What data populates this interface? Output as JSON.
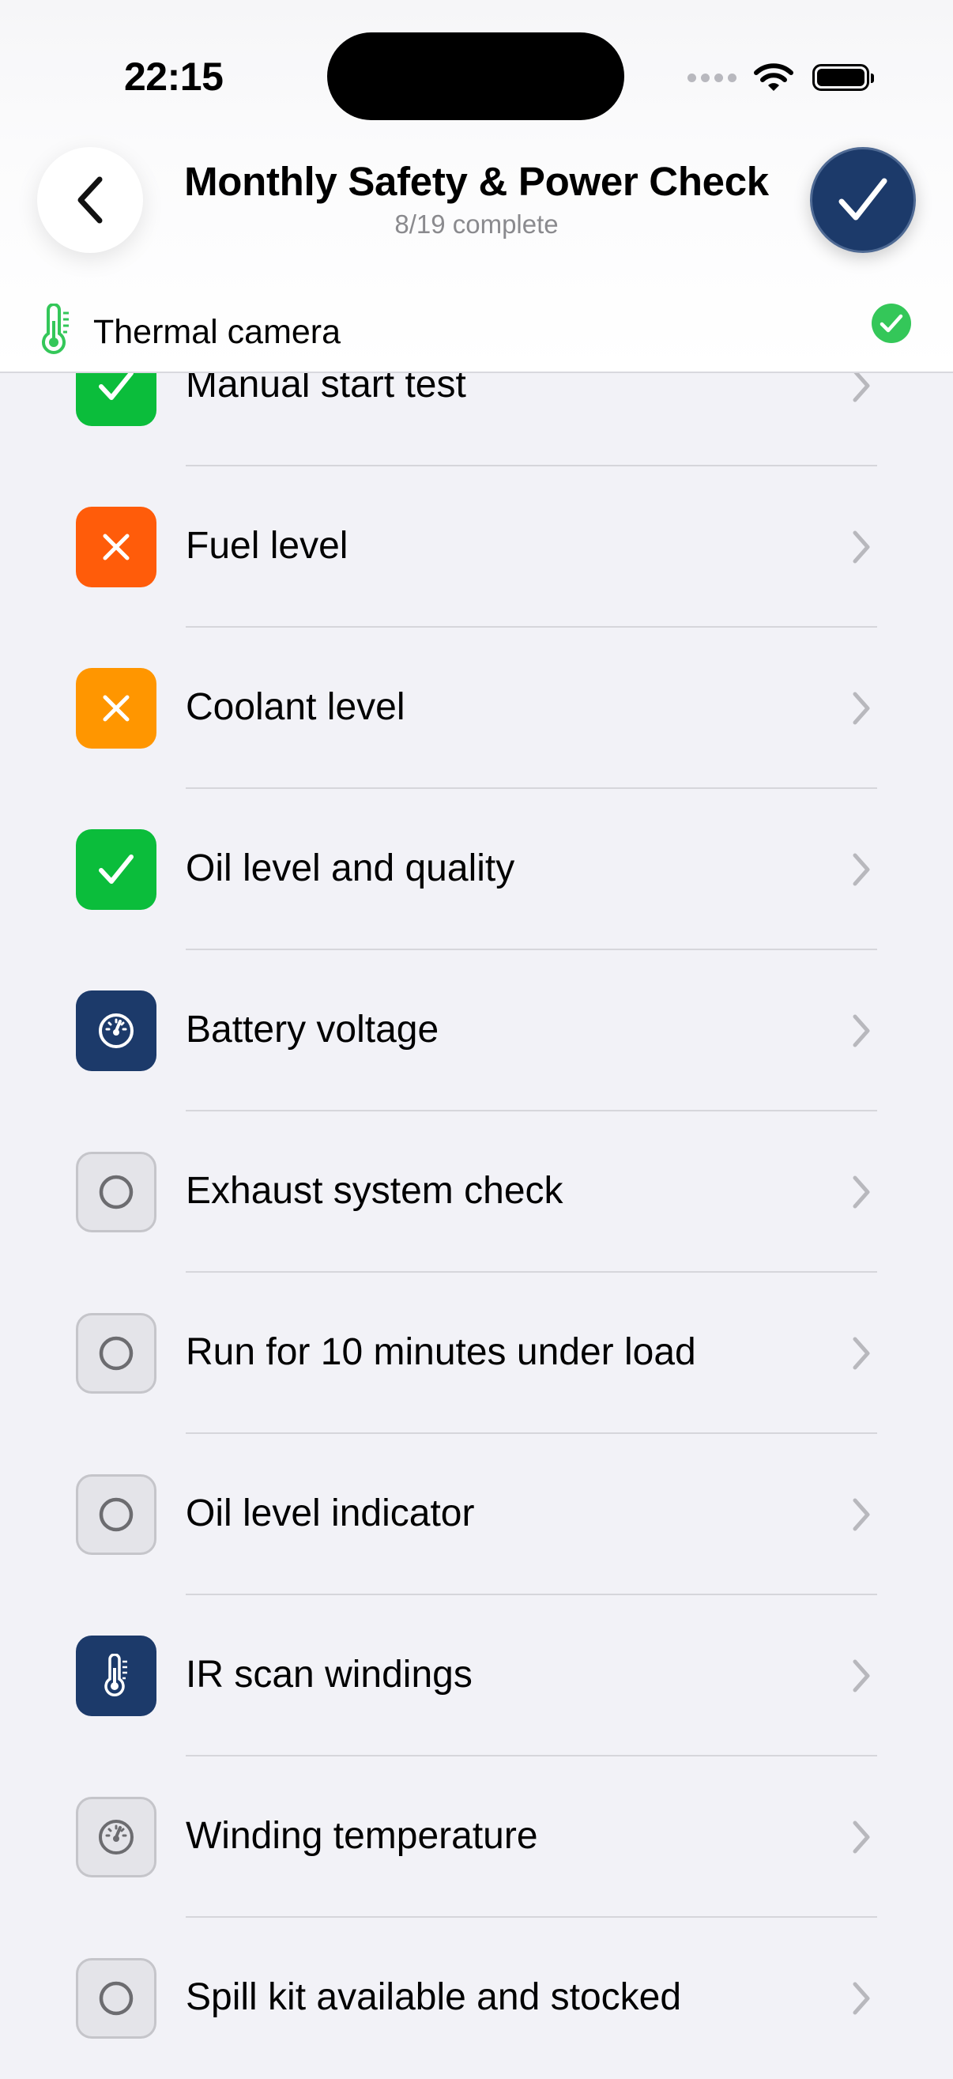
{
  "status_bar": {
    "time": "22:15"
  },
  "header": {
    "title": "Monthly Safety & Power Check",
    "subtitle": "8/19 complete",
    "back_icon": "chevron-left-icon",
    "done_icon": "checkmark-icon"
  },
  "tool": {
    "label": "Thermal camera",
    "icon": "thermometer-icon",
    "status": "complete"
  },
  "colors": {
    "pass": "#0bbd3b",
    "fail_red": "#ff5c0a",
    "fail_orange": "#ff9600",
    "measure_navy": "#1c3a6a",
    "tool_green": "#34c759"
  },
  "items": [
    {
      "label": "Manual start test",
      "state": "pass",
      "icon": "checkmark-icon"
    },
    {
      "label": "Fuel level",
      "state": "fail-red",
      "icon": "x-mark-icon"
    },
    {
      "label": "Coolant level",
      "state": "fail-orange",
      "icon": "x-mark-icon"
    },
    {
      "label": "Oil level and quality",
      "state": "pass",
      "icon": "checkmark-icon"
    },
    {
      "label": "Battery voltage",
      "state": "measure",
      "icon": "gauge-icon"
    },
    {
      "label": "Exhaust system check",
      "state": "todo",
      "icon": "circle-icon"
    },
    {
      "label": "Run for 10 minutes under load",
      "state": "todo",
      "icon": "circle-icon"
    },
    {
      "label": "Oil level indicator",
      "state": "todo",
      "icon": "circle-icon"
    },
    {
      "label": "IR scan windings",
      "state": "measure",
      "icon": "thermometer-icon"
    },
    {
      "label": "Winding temperature",
      "state": "todo",
      "icon": "gauge-icon"
    },
    {
      "label": "Spill kit available and stocked",
      "state": "todo",
      "icon": "circle-icon"
    }
  ]
}
